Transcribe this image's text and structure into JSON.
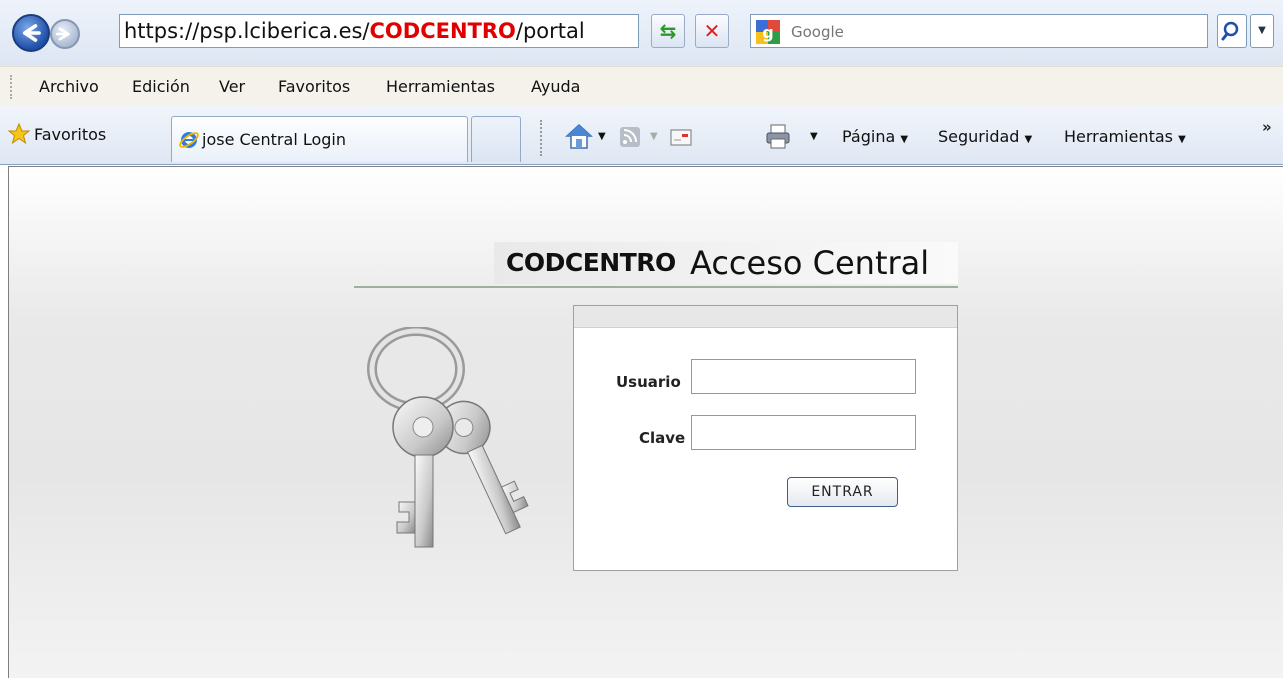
{
  "browser": {
    "url_prefix": "https://psp.lciberica.es/",
    "url_highlight": "CODCENTRO",
    "url_suffix": "/portal",
    "search_placeholder": "Google"
  },
  "menu": {
    "items": [
      "Archivo",
      "Edición",
      "Ver",
      "Favoritos",
      "Herramientas",
      "Ayuda"
    ]
  },
  "favbar": {
    "favorites_label": "Favoritos",
    "tab_title": "jose Central Login",
    "commands": {
      "page": "Página",
      "security": "Seguridad",
      "tools": "Herramientas"
    }
  },
  "page": {
    "title_code": "CODCENTRO",
    "title_text": "Acceso Central",
    "user_label": "Usuario",
    "password_label": "Clave",
    "user_value": "",
    "password_value": "",
    "submit_label": "ENTRAR"
  },
  "icons": {
    "back": "back-arrow-icon",
    "forward": "forward-arrow-icon",
    "refresh": "refresh-icon",
    "stop": "stop-icon",
    "search": "magnifier-icon",
    "favorites": "star-icon",
    "tab": "ie-logo-icon",
    "home": "home-icon",
    "feeds": "rss-icon",
    "mail": "mail-icon",
    "print": "printer-icon",
    "keys": "keys-icon"
  },
  "colors": {
    "url_highlight": "#e00000",
    "chrome_blue": "#dde6f3",
    "menu_bg": "#f4f2ea"
  }
}
